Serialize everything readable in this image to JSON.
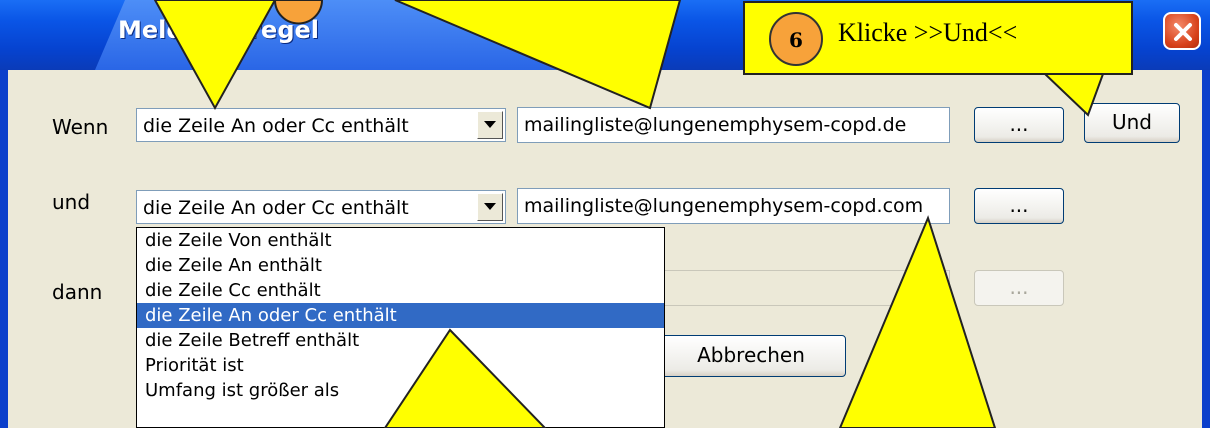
{
  "window": {
    "title": "Meldungsregel"
  },
  "rows": [
    {
      "label": "Wenn",
      "condition": "die Zeile An oder Cc enthält",
      "value": "mailingliste@lungenemphysem-copd.de",
      "browse_label": "...",
      "and_label": "Und"
    },
    {
      "label": "und",
      "condition": "die Zeile An oder Cc enthält",
      "value": "mailingliste@lungenemphysem-copd.com",
      "browse_label": "..."
    },
    {
      "label": "dann",
      "browse_label": "..."
    }
  ],
  "dropdown": {
    "items": [
      "die Zeile Von enthält",
      "die Zeile An enthält",
      "die Zeile Cc enthält",
      "die Zeile An oder Cc enthält",
      "die Zeile Betreff enthält",
      "Priorität ist",
      "Umfang ist größer als"
    ],
    "selected_index": 3
  },
  "buttons": {
    "cancel": "Abbrechen"
  },
  "callout": {
    "number": "6",
    "text": "Klicke >>Und<<"
  },
  "colors": {
    "titlebar": "#0a55e6",
    "client": "#ece9d8",
    "selection": "#316ac5",
    "callout": "#ffff00",
    "badge": "#f7a23a"
  }
}
